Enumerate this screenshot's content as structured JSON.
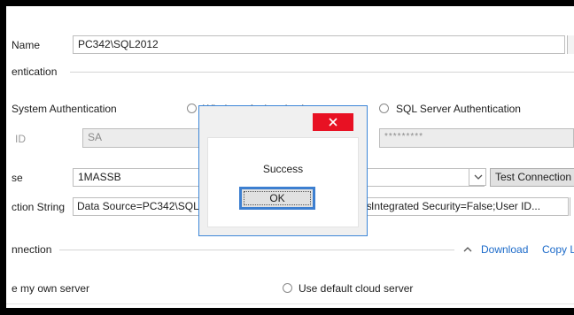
{
  "server": {
    "label": "Name",
    "value": "PC342\\SQL2012"
  },
  "authentication": {
    "group_label": "entication",
    "system_option": "System Authentication",
    "windows_option": "Windows Authentication",
    "sql_option": "SQL Server Authentication",
    "id_label": "ID",
    "user_value": "SA",
    "password_mask": "*********"
  },
  "database": {
    "label": "se",
    "value": "1MASSB",
    "test_button": "Test Connection"
  },
  "connection_string": {
    "label": "ction String",
    "value_left": "Data Source=PC342\\SQL2012;Initial Catalog=1MASSB;Persist Security Info=True;",
    "value_right": "Integrated Security=False;User ID..."
  },
  "connection_section": {
    "label": "nnection",
    "download_link": "Download",
    "copy_link": "Copy Link"
  },
  "server_choice": {
    "own_option": "e my own server",
    "cloud_option": "Use default cloud server"
  },
  "dialog": {
    "message": "Success",
    "ok_label": "OK"
  },
  "colors": {
    "accent": "#3c86d8",
    "close_red": "#e81123",
    "link": "#1b6ac9"
  }
}
